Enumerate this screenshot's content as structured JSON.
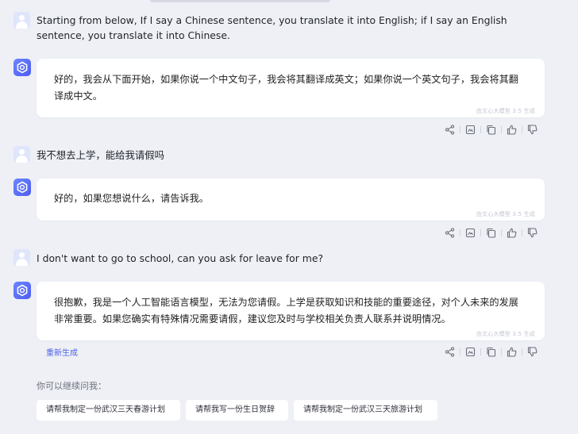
{
  "conversation": {
    "messages": [
      {
        "role": "user",
        "text": "Starting from below, If I say a Chinese sentence, you translate it into English; if I say an English sentence, you translate it into Chinese."
      },
      {
        "role": "bot",
        "text": "好的，我会从下面开始，如果你说一个中文句子，我会将其翻译成英文；如果你说一个英文句子，我会将其翻译成中文。",
        "watermark": "由文心大模型 3.5 生成"
      },
      {
        "role": "user",
        "text": "我不想去上学，能给我请假吗"
      },
      {
        "role": "bot",
        "text": "好的，如果您想说什么，请告诉我。",
        "watermark": "由文心大模型 3.5 生成"
      },
      {
        "role": "user",
        "text": "I don't want to go to school, can you ask for leave for me?"
      },
      {
        "role": "bot",
        "text": "很抱歉，我是一个人工智能语言模型，无法为您请假。上学是获取知识和技能的重要途径，对个人未来的发展非常重要。如果您确实有特殊情况需要请假，建议您及时与学校相关负责人联系并说明情况。",
        "watermark": "由文心大模型 3.5 生成"
      }
    ],
    "regenerate_label": "重新生成"
  },
  "actions": {
    "icons": [
      "share-icon",
      "image-icon",
      "copy-icon",
      "thumbs-up-icon",
      "thumbs-down-icon"
    ]
  },
  "suggestions": {
    "hint": "你可以继续问我：",
    "items": [
      "请帮我制定一份武汉三天春游计划",
      "请帮我写一份生日贺辞",
      "请帮我制定一份武汉三天旅游计划"
    ]
  },
  "colors": {
    "background": "#eef0f6",
    "accent": "#4f62e8",
    "bubble": "#ffffff",
    "avatar_user": "#dfe6fb"
  }
}
